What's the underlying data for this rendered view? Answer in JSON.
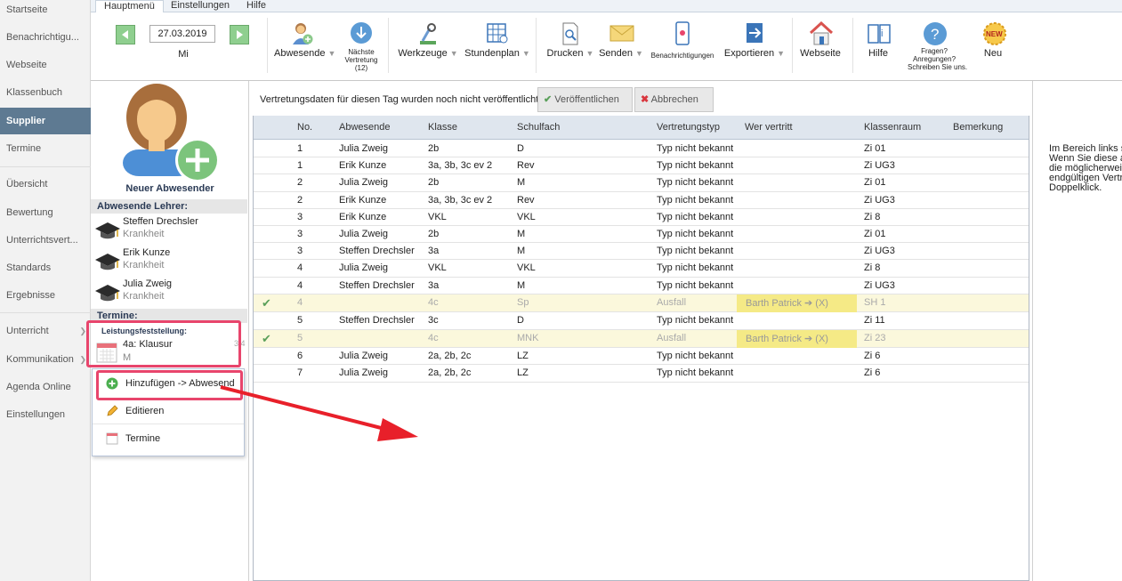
{
  "nav": {
    "items": [
      {
        "label": "Startseite"
      },
      {
        "label": "Benachrichtigu..."
      },
      {
        "label": "Webseite"
      },
      {
        "label": "Klassenbuch"
      },
      {
        "label": "Supplier"
      },
      {
        "label": "Termine"
      },
      {
        "label": "Übersicht"
      },
      {
        "label": "Bewertung"
      },
      {
        "label": "Unterrichtsvert..."
      },
      {
        "label": "Standards"
      },
      {
        "label": "Ergebnisse"
      },
      {
        "label": "Unterricht"
      },
      {
        "label": "Kommunikation"
      },
      {
        "label": "Agenda Online"
      },
      {
        "label": "Einstellungen"
      }
    ]
  },
  "tabs": [
    "Hauptmenü",
    "Einstellungen",
    "Hilfe"
  ],
  "ribbon": {
    "date": "27.03.2019",
    "weekday": "Mi",
    "abwesende": "Abwesende",
    "naechste_line1": "Nächste",
    "naechste_line2": "Vertretung",
    "naechste_line3": "(12)",
    "werkzeuge": "Werkzeuge",
    "stundenplan": "Stundenplan",
    "drucken": "Drucken",
    "senden": "Senden",
    "benachrichtigungen": "Benachrichtigungen",
    "exportieren": "Exportieren",
    "webseite": "Webseite",
    "hilfe": "Hilfe",
    "fragen_line1": "Fragen?",
    "fragen_line2": "Anregungen?",
    "fragen_line3": "Schreiben Sie uns.",
    "neu": "Neu",
    "new_badge": "NEW"
  },
  "left": {
    "new_absent": "Neuer Abwesender",
    "absent_header": "Abwesende Lehrer:",
    "teachers": [
      {
        "name": "Steffen Drechsler",
        "reason": "Krankheit"
      },
      {
        "name": "Erik Kunze",
        "reason": "Krankheit"
      },
      {
        "name": "Julia Zweig",
        "reason": "Krankheit"
      }
    ],
    "termine_header": "Termine:",
    "termin_category": "Leistungsfeststellung:",
    "termin_title": "4a: Klausur",
    "termin_sub": "M",
    "termin_count": "3/4"
  },
  "popup": {
    "items": [
      "Hinzufügen -> Abwesend",
      "Editieren",
      "Termine"
    ]
  },
  "main": {
    "status_text": "Vertretungsdaten für diesen Tag wurden noch nicht veröffentlicht.",
    "publish_label": "Veröffentlichen",
    "cancel_label": "Abbrechen",
    "columns": [
      "No.",
      "Abwesende",
      "Klasse",
      "Schulfach",
      "Vertretungstyp",
      "Wer vertritt",
      "Klassenraum",
      "Bemerkung"
    ],
    "rows": [
      {
        "check": "",
        "no": "1",
        "abw": "Julia Zweig",
        "klasse": "2b",
        "fach": "D",
        "typ": "Typ nicht bekannt",
        "wer": "",
        "raum": "Zi 01"
      },
      {
        "check": "",
        "no": "1",
        "abw": "Erik Kunze",
        "klasse": "3a, 3b, 3c ev 2",
        "fach": "Rev",
        "typ": "Typ nicht bekannt",
        "wer": "",
        "raum": "Zi UG3"
      },
      {
        "check": "",
        "no": "2",
        "abw": "Julia Zweig",
        "klasse": "2b",
        "fach": "M",
        "typ": "Typ nicht bekannt",
        "wer": "",
        "raum": "Zi 01"
      },
      {
        "check": "",
        "no": "2",
        "abw": "Erik Kunze",
        "klasse": "3a, 3b, 3c ev 2",
        "fach": "Rev",
        "typ": "Typ nicht bekannt",
        "wer": "",
        "raum": "Zi UG3"
      },
      {
        "check": "",
        "no": "3",
        "abw": "Erik Kunze",
        "klasse": "VKL",
        "fach": "VKL",
        "typ": "Typ nicht bekannt",
        "wer": "",
        "raum": "Zi 8"
      },
      {
        "check": "",
        "no": "3",
        "abw": "Julia Zweig",
        "klasse": "2b",
        "fach": "M",
        "typ": "Typ nicht bekannt",
        "wer": "",
        "raum": "Zi 01"
      },
      {
        "check": "",
        "no": "3",
        "abw": "Steffen Drechsler",
        "klasse": "3a",
        "fach": "M",
        "typ": "Typ nicht bekannt",
        "wer": "",
        "raum": "Zi UG3"
      },
      {
        "check": "",
        "no": "4",
        "abw": "Julia Zweig",
        "klasse": "VKL",
        "fach": "VKL",
        "typ": "Typ nicht bekannt",
        "wer": "",
        "raum": "Zi 8"
      },
      {
        "check": "",
        "no": "4",
        "abw": "Steffen Drechsler",
        "klasse": "3a",
        "fach": "M",
        "typ": "Typ nicht bekannt",
        "wer": "",
        "raum": "Zi UG3"
      },
      {
        "check": "✔",
        "no": "4",
        "abw": "",
        "klasse": "4c",
        "fach": "Sp",
        "typ": "Ausfall",
        "wer": "Barth Patrick ➔ (X)",
        "raum": "SH 1"
      },
      {
        "check": "",
        "no": "5",
        "abw": "Steffen Drechsler",
        "klasse": "3c",
        "fach": "D",
        "typ": "Typ nicht bekannt",
        "wer": "",
        "raum": "Zi 11"
      },
      {
        "check": "✔",
        "no": "5",
        "abw": "",
        "klasse": "4c",
        "fach": "MNK",
        "typ": "Ausfall",
        "wer": "Barth Patrick ➔ (X)",
        "raum": "Zi 23"
      },
      {
        "check": "",
        "no": "6",
        "abw": "Julia Zweig",
        "klasse": "2a, 2b, 2c",
        "fach": "LZ",
        "typ": "Typ nicht bekannt",
        "wer": "",
        "raum": "Zi 6"
      },
      {
        "check": "",
        "no": "7",
        "abw": "Julia Zweig",
        "klasse": "2a, 2b, 2c",
        "fach": "LZ",
        "typ": "Typ nicht bekannt",
        "wer": "",
        "raum": "Zi 6"
      }
    ]
  },
  "right": {
    "text": "Im Bereich links s\nWenn Sie diese a\ndie möglicherweis\nendgültigen Vertre\nDoppelklick."
  },
  "colors": {
    "nav_active": "#5e7a92",
    "highlight_row": "#fbf8dc",
    "wer_vertritt_bg": "#f5ea86",
    "annotation_red": "#e8456c"
  }
}
